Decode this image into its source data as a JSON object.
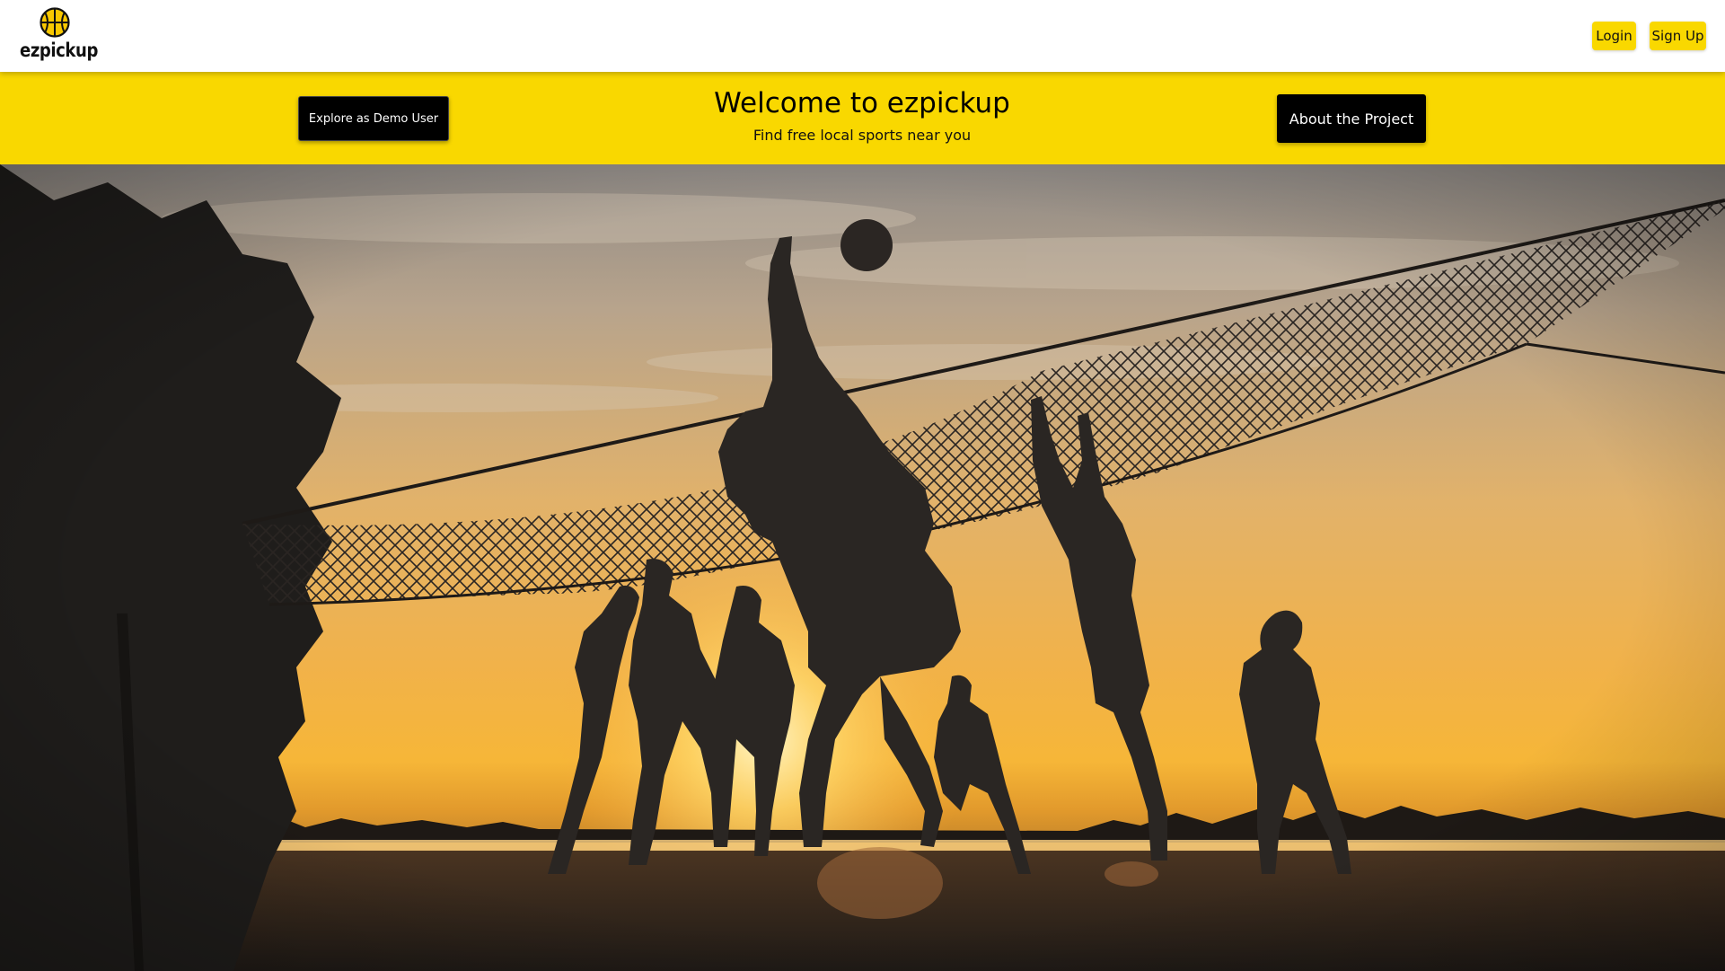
{
  "brand": {
    "name": "ezpickup",
    "logo_icon": "basketball-icon",
    "accent_color": "#f9d800"
  },
  "nav": {
    "login_label": "Login",
    "signup_label": "Sign Up"
  },
  "banner": {
    "title": "Welcome to ezpickup",
    "subtitle": "Find free local sports near you",
    "demo_button_label": "Explore as Demo User",
    "about_button_label": "About the Project",
    "background_color": "#f9d800"
  },
  "hero": {
    "image_subject": "beach-volleyball-sunset-photo"
  }
}
